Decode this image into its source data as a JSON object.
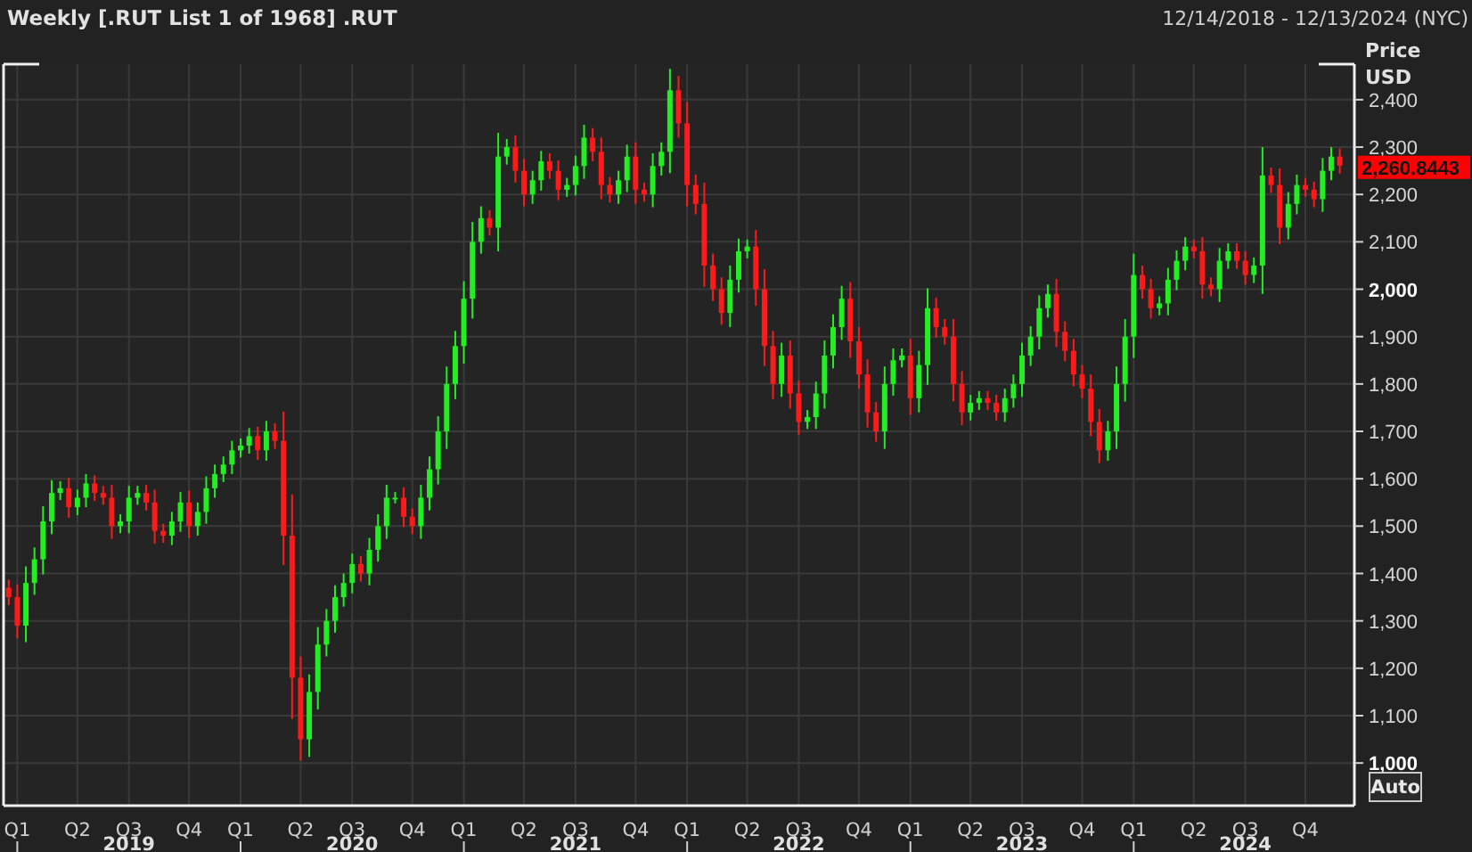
{
  "header": {
    "title": "Weekly [.RUT List 1 of 1968] .RUT",
    "date_range": "12/14/2018 - 12/13/2024 (NYC)"
  },
  "chart": {
    "axis_title": "Price",
    "axis_unit": "USD",
    "last_price": "2,260.8443",
    "scale_button": "Auto",
    "ytick_bold": [
      false,
      false,
      false,
      false,
      true,
      false,
      false,
      false,
      false,
      false,
      false,
      false,
      false,
      false,
      true
    ],
    "year_labels": [
      "2019",
      "2020",
      "2021",
      "2022",
      "2023",
      "2024"
    ],
    "chart_data": {
      "type": "candlestick",
      "ylim": [
        910,
        2475
      ],
      "grid": true,
      "yticks": [
        {
          "value": 2400,
          "label": "2,400"
        },
        {
          "value": 2300,
          "label": "2,300"
        },
        {
          "value": 2200,
          "label": "2,200"
        },
        {
          "value": 2100,
          "label": "2,100"
        },
        {
          "value": 2000,
          "label": "2,000"
        },
        {
          "value": 1900,
          "label": "1,900"
        },
        {
          "value": 1800,
          "label": "1,800"
        },
        {
          "value": 1700,
          "label": "1,700"
        },
        {
          "value": 1600,
          "label": "1,600"
        },
        {
          "value": 1500,
          "label": "1,500"
        },
        {
          "value": 1400,
          "label": "1,400"
        },
        {
          "value": 1300,
          "label": "1,300"
        },
        {
          "value": 1200,
          "label": "1,200"
        },
        {
          "value": 1100,
          "label": "1,100"
        },
        {
          "value": 1000,
          "label": "1,000"
        }
      ],
      "categories": [
        null,
        "Q1",
        null,
        null,
        null,
        null,
        null,
        null,
        "Q2",
        null,
        null,
        null,
        null,
        null,
        "Q3",
        null,
        null,
        null,
        null,
        null,
        null,
        "Q4",
        null,
        null,
        null,
        null,
        null,
        "Q1",
        null,
        null,
        null,
        null,
        null,
        null,
        "Q2",
        null,
        null,
        null,
        null,
        null,
        "Q3",
        null,
        null,
        null,
        null,
        null,
        null,
        "Q4",
        null,
        null,
        null,
        null,
        null,
        "Q1",
        null,
        null,
        null,
        null,
        null,
        null,
        "Q2",
        null,
        null,
        null,
        null,
        null,
        "Q3",
        null,
        null,
        null,
        null,
        null,
        null,
        "Q4",
        null,
        null,
        null,
        null,
        null,
        "Q1",
        null,
        null,
        null,
        null,
        null,
        null,
        "Q2",
        null,
        null,
        null,
        null,
        null,
        "Q3",
        null,
        null,
        null,
        null,
        null,
        null,
        "Q4",
        null,
        null,
        null,
        null,
        null,
        "Q1",
        null,
        null,
        null,
        null,
        null,
        null,
        "Q2",
        null,
        null,
        null,
        null,
        null,
        "Q3",
        null,
        null,
        null,
        null,
        null,
        null,
        "Q4",
        null,
        null,
        null,
        null,
        null,
        "Q1",
        null,
        null,
        null,
        null,
        null,
        null,
        "Q2",
        null,
        null,
        null,
        null,
        null,
        "Q3",
        null,
        null,
        null,
        null,
        null,
        null,
        "Q4",
        null,
        null,
        null,
        null
      ],
      "ohlc": [
        [
          1370,
          1387,
          1333,
          1350
        ],
        [
          1350,
          1377,
          1263,
          1290
        ],
        [
          1290,
          1415,
          1255,
          1380
        ],
        [
          1380,
          1455,
          1355,
          1430
        ],
        [
          1430,
          1542,
          1398,
          1510
        ],
        [
          1510,
          1597,
          1483,
          1570
        ],
        [
          1570,
          1595,
          1555,
          1580
        ],
        [
          1580,
          1602,
          1518,
          1540
        ],
        [
          1540,
          1577,
          1523,
          1560
        ],
        [
          1560,
          1610,
          1540,
          1590
        ],
        [
          1590,
          1607,
          1553,
          1570
        ],
        [
          1570,
          1585,
          1545,
          1560
        ],
        [
          1560,
          1587,
          1473,
          1500
        ],
        [
          1500,
          1525,
          1485,
          1510
        ],
        [
          1510,
          1585,
          1485,
          1560
        ],
        [
          1560,
          1585,
          1545,
          1570
        ],
        [
          1570,
          1587,
          1533,
          1550
        ],
        [
          1550,
          1577,
          1463,
          1490
        ],
        [
          1490,
          1505,
          1465,
          1480
        ],
        [
          1480,
          1530,
          1460,
          1510
        ],
        [
          1510,
          1572,
          1488,
          1550
        ],
        [
          1550,
          1575,
          1475,
          1500
        ],
        [
          1500,
          1550,
          1480,
          1530
        ],
        [
          1530,
          1605,
          1505,
          1580
        ],
        [
          1580,
          1630,
          1560,
          1610
        ],
        [
          1610,
          1647,
          1593,
          1630
        ],
        [
          1630,
          1680,
          1610,
          1660
        ],
        [
          1660,
          1685,
          1645,
          1670
        ],
        [
          1670,
          1707,
          1653,
          1690
        ],
        [
          1690,
          1710,
          1640,
          1660
        ],
        [
          1660,
          1722,
          1638,
          1700
        ],
        [
          1700,
          1717,
          1663,
          1680
        ],
        [
          1680,
          1742,
          1418,
          1480
        ],
        [
          1480,
          1567,
          1093,
          1180
        ],
        [
          1180,
          1225,
          1005,
          1050
        ],
        [
          1050,
          1187,
          1013,
          1150
        ],
        [
          1150,
          1287,
          1113,
          1250
        ],
        [
          1250,
          1325,
          1225,
          1300
        ],
        [
          1300,
          1375,
          1275,
          1350
        ],
        [
          1350,
          1400,
          1330,
          1380
        ],
        [
          1380,
          1442,
          1358,
          1420
        ],
        [
          1420,
          1437,
          1383,
          1400
        ],
        [
          1400,
          1475,
          1375,
          1450
        ],
        [
          1450,
          1525,
          1425,
          1500
        ],
        [
          1500,
          1587,
          1473,
          1560
        ],
        [
          1560,
          1572,
          1548,
          1560
        ],
        [
          1560,
          1582,
          1498,
          1520
        ],
        [
          1520,
          1537,
          1483,
          1500
        ],
        [
          1500,
          1587,
          1473,
          1560
        ],
        [
          1560,
          1647,
          1533,
          1620
        ],
        [
          1620,
          1732,
          1588,
          1700
        ],
        [
          1700,
          1837,
          1663,
          1800
        ],
        [
          1800,
          1912,
          1768,
          1880
        ],
        [
          1880,
          2017,
          1843,
          1980
        ],
        [
          1980,
          2142,
          1938,
          2100
        ],
        [
          2100,
          2175,
          2075,
          2150
        ],
        [
          2150,
          2167,
          2113,
          2130
        ],
        [
          2130,
          2330,
          2080,
          2280
        ],
        [
          2280,
          2317,
          2263,
          2300
        ],
        [
          2300,
          2325,
          2225,
          2250
        ],
        [
          2250,
          2275,
          2175,
          2200
        ],
        [
          2200,
          2250,
          2180,
          2230
        ],
        [
          2230,
          2292,
          2208,
          2270
        ],
        [
          2270,
          2287,
          2233,
          2250
        ],
        [
          2250,
          2272,
          2188,
          2210
        ],
        [
          2210,
          2235,
          2195,
          2220
        ],
        [
          2220,
          2282,
          2198,
          2260
        ],
        [
          2260,
          2347,
          2233,
          2320
        ],
        [
          2320,
          2340,
          2270,
          2290
        ],
        [
          2290,
          2320,
          2190,
          2220
        ],
        [
          2220,
          2237,
          2183,
          2200
        ],
        [
          2200,
          2250,
          2180,
          2230
        ],
        [
          2230,
          2305,
          2205,
          2280
        ],
        [
          2280,
          2310,
          2180,
          2210
        ],
        [
          2210,
          2225,
          2185,
          2200
        ],
        [
          2200,
          2287,
          2173,
          2260
        ],
        [
          2260,
          2310,
          2240,
          2290
        ],
        [
          2290,
          2465,
          2245,
          2420
        ],
        [
          2420,
          2450,
          2320,
          2350
        ],
        [
          2350,
          2395,
          2175,
          2220
        ],
        [
          2220,
          2242,
          2158,
          2180
        ],
        [
          2180,
          2225,
          2005,
          2050
        ],
        [
          2050,
          2075,
          1975,
          2000
        ],
        [
          2000,
          2025,
          1925,
          1950
        ],
        [
          1950,
          2050,
          1920,
          2020
        ],
        [
          2020,
          2107,
          1993,
          2080
        ],
        [
          2080,
          2105,
          2065,
          2090
        ],
        [
          2090,
          2125,
          1965,
          2000
        ],
        [
          2000,
          2042,
          1838,
          1880
        ],
        [
          1880,
          1912,
          1768,
          1800
        ],
        [
          1800,
          1887,
          1773,
          1860
        ],
        [
          1860,
          1892,
          1748,
          1780
        ],
        [
          1780,
          1807,
          1693,
          1720
        ],
        [
          1720,
          1745,
          1705,
          1730
        ],
        [
          1730,
          1805,
          1705,
          1780
        ],
        [
          1780,
          1892,
          1748,
          1860
        ],
        [
          1860,
          1947,
          1833,
          1920
        ],
        [
          1920,
          2007,
          1893,
          1980
        ],
        [
          1980,
          2015,
          1855,
          1890
        ],
        [
          1890,
          1920,
          1790,
          1820
        ],
        [
          1820,
          1852,
          1708,
          1740
        ],
        [
          1740,
          1762,
          1678,
          1700
        ],
        [
          1700,
          1837,
          1663,
          1800
        ],
        [
          1800,
          1875,
          1775,
          1850
        ],
        [
          1850,
          1875,
          1835,
          1860
        ],
        [
          1860,
          1895,
          1735,
          1770
        ],
        [
          1770,
          1870,
          1740,
          1840
        ],
        [
          1840,
          2002,
          1798,
          1960
        ],
        [
          1960,
          1982,
          1898,
          1920
        ],
        [
          1920,
          1937,
          1883,
          1900
        ],
        [
          1900,
          1937,
          1763,
          1800
        ],
        [
          1800,
          1827,
          1713,
          1740
        ],
        [
          1740,
          1777,
          1723,
          1760
        ],
        [
          1760,
          1785,
          1745,
          1770
        ],
        [
          1770,
          1785,
          1745,
          1760
        ],
        [
          1760,
          1777,
          1723,
          1740
        ],
        [
          1740,
          1790,
          1720,
          1770
        ],
        [
          1770,
          1820,
          1750,
          1800
        ],
        [
          1800,
          1887,
          1773,
          1860
        ],
        [
          1860,
          1922,
          1838,
          1900
        ],
        [
          1900,
          1987,
          1873,
          1960
        ],
        [
          1960,
          2010,
          1940,
          1990
        ],
        [
          1990,
          2022,
          1878,
          1910
        ],
        [
          1910,
          1932,
          1848,
          1870
        ],
        [
          1870,
          1895,
          1795,
          1820
        ],
        [
          1820,
          1840,
          1770,
          1790
        ],
        [
          1790,
          1820,
          1690,
          1720
        ],
        [
          1720,
          1747,
          1633,
          1660
        ],
        [
          1660,
          1722,
          1638,
          1700
        ],
        [
          1700,
          1837,
          1663,
          1800
        ],
        [
          1800,
          1937,
          1763,
          1900
        ],
        [
          1900,
          2075,
          1855,
          2030
        ],
        [
          2030,
          2050,
          1980,
          2000
        ],
        [
          2000,
          2022,
          1938,
          1960
        ],
        [
          1960,
          1985,
          1945,
          1970
        ],
        [
          1970,
          2045,
          1945,
          2020
        ],
        [
          2020,
          2082,
          1998,
          2060
        ],
        [
          2060,
          2110,
          2040,
          2090
        ],
        [
          2090,
          2105,
          2065,
          2080
        ],
        [
          2080,
          2110,
          1980,
          2010
        ],
        [
          2010,
          2025,
          1985,
          2000
        ],
        [
          2000,
          2087,
          1973,
          2060
        ],
        [
          2060,
          2097,
          2043,
          2080
        ],
        [
          2080,
          2097,
          2043,
          2060
        ],
        [
          2060,
          2080,
          2010,
          2030
        ],
        [
          2030,
          2067,
          2013,
          2050
        ],
        [
          2050,
          2300,
          1990,
          2240
        ],
        [
          2240,
          2257,
          2203,
          2220
        ],
        [
          2220,
          2255,
          2095,
          2130
        ],
        [
          2130,
          2205,
          2105,
          2180
        ],
        [
          2180,
          2242,
          2158,
          2220
        ],
        [
          2220,
          2235,
          2195,
          2210
        ],
        [
          2210,
          2227,
          2173,
          2190
        ],
        [
          2190,
          2277,
          2163,
          2250
        ],
        [
          2250,
          2300,
          2230,
          2280
        ],
        [
          2280,
          2297,
          2244,
          2261
        ]
      ]
    }
  }
}
